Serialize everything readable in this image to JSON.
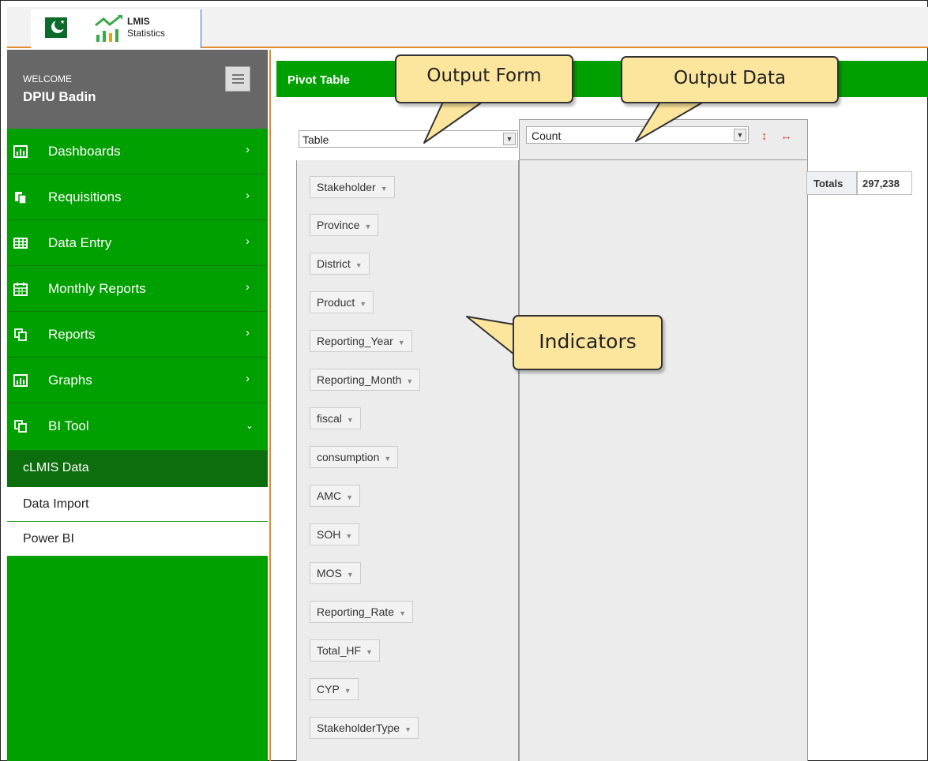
{
  "header": {
    "app_title": "LMIS",
    "app_subtitle": "Statistics"
  },
  "sidebar": {
    "welcome_label": "WELCOME",
    "user_name": "DPIU Badin",
    "items": [
      {
        "label": "Dashboards",
        "icon": "bar-chart-icon"
      },
      {
        "label": "Requisitions",
        "icon": "document-icon"
      },
      {
        "label": "Data Entry",
        "icon": "table-icon"
      },
      {
        "label": "Monthly Reports",
        "icon": "calendar-icon"
      },
      {
        "label": "Reports",
        "icon": "copy-icon"
      },
      {
        "label": "Graphs",
        "icon": "bar-chart-icon"
      },
      {
        "label": "BI Tool",
        "icon": "copy-icon",
        "expanded": true
      }
    ],
    "subitems": [
      {
        "label": "cLMIS Data",
        "active": true
      },
      {
        "label": "Data Import"
      },
      {
        "label": "Power BI"
      }
    ]
  },
  "main": {
    "title": "Pivot Table",
    "renderer_selected": "Table",
    "aggregator_selected": "Count",
    "attributes": [
      "Stakeholder",
      "Province",
      "District",
      "Product",
      "Reporting_Year",
      "Reporting_Month",
      "fiscal",
      "consumption",
      "AMC",
      "SOH",
      "MOS",
      "Reporting_Rate",
      "Total_HF",
      "CYP",
      "StakeholderType"
    ],
    "totals_label": "Totals",
    "totals_value": "297,238"
  },
  "callouts": {
    "output_form": "Output Form",
    "output_data": "Output Data",
    "indicators": "Indicators"
  },
  "colors": {
    "sidebar_green": "#00a000",
    "active_green": "#0d6e0d",
    "welcome_gray": "#676767",
    "accent_orange": "#e88a2a",
    "callout_yellow": "#fce59d"
  }
}
